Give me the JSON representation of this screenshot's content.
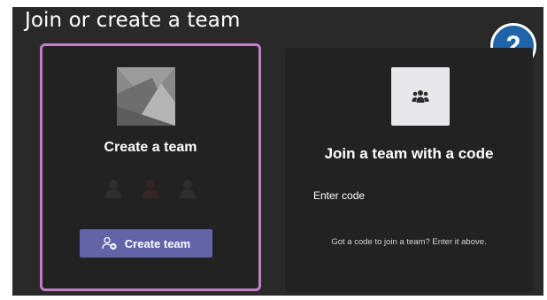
{
  "header": {
    "title": "Join or create a team"
  },
  "step_badge": {
    "number": "2"
  },
  "create_card": {
    "title": "Create a team",
    "button_label": "Create team",
    "thumbnail_icon": "team-placeholder-image",
    "button_icon": "add-people-icon",
    "highlight_color": "#c27fc4"
  },
  "join_card": {
    "title": "Join a team with a code",
    "code_placeholder": "Enter code",
    "hint": "Got a code to join a team? Enter it above.",
    "thumbnail_icon": "people-group-icon"
  },
  "colors": {
    "background": "#292929",
    "card": "#222222",
    "accent": "#6264a7",
    "badge": "#1f63a8"
  }
}
